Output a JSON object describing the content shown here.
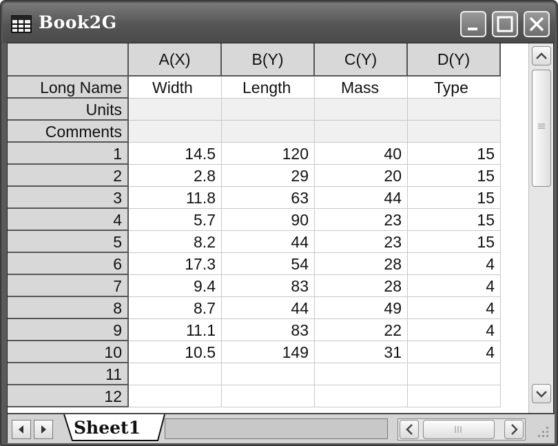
{
  "window": {
    "title": "Book2G",
    "icon": "worksheet-icon",
    "buttons": [
      "minimize-icon",
      "maximize-icon",
      "close-icon"
    ]
  },
  "grid": {
    "columns": [
      "A(X)",
      "B(Y)",
      "C(Y)",
      "D(Y)"
    ],
    "meta_labels": {
      "long_name": "Long Name",
      "units": "Units",
      "comments": "Comments"
    },
    "long_names": [
      "Width",
      "Length",
      "Mass",
      "Type"
    ],
    "units": [
      "",
      "",
      "",
      ""
    ],
    "comments": [
      "",
      "",
      "",
      ""
    ],
    "rows": [
      {
        "n": "1",
        "cells": [
          "14.5",
          "120",
          "40",
          "15"
        ]
      },
      {
        "n": "2",
        "cells": [
          "2.8",
          "29",
          "20",
          "15"
        ]
      },
      {
        "n": "3",
        "cells": [
          "11.8",
          "63",
          "44",
          "15"
        ]
      },
      {
        "n": "4",
        "cells": [
          "5.7",
          "90",
          "23",
          "15"
        ]
      },
      {
        "n": "5",
        "cells": [
          "8.2",
          "44",
          "23",
          "15"
        ]
      },
      {
        "n": "6",
        "cells": [
          "17.3",
          "54",
          "28",
          "4"
        ]
      },
      {
        "n": "7",
        "cells": [
          "9.4",
          "83",
          "28",
          "4"
        ]
      },
      {
        "n": "8",
        "cells": [
          "8.7",
          "44",
          "49",
          "4"
        ]
      },
      {
        "n": "9",
        "cells": [
          "11.1",
          "83",
          "22",
          "4"
        ]
      },
      {
        "n": "10",
        "cells": [
          "10.5",
          "149",
          "31",
          "4"
        ]
      },
      {
        "n": "11",
        "cells": [
          "",
          "",
          "",
          ""
        ]
      },
      {
        "n": "12",
        "cells": [
          "",
          "",
          "",
          ""
        ]
      }
    ]
  },
  "sheet_tabs": [
    "Sheet1"
  ],
  "colors": {
    "titlebar": "#555555",
    "header": "#d8d8d8",
    "grid_line": "#c8c8c8"
  }
}
